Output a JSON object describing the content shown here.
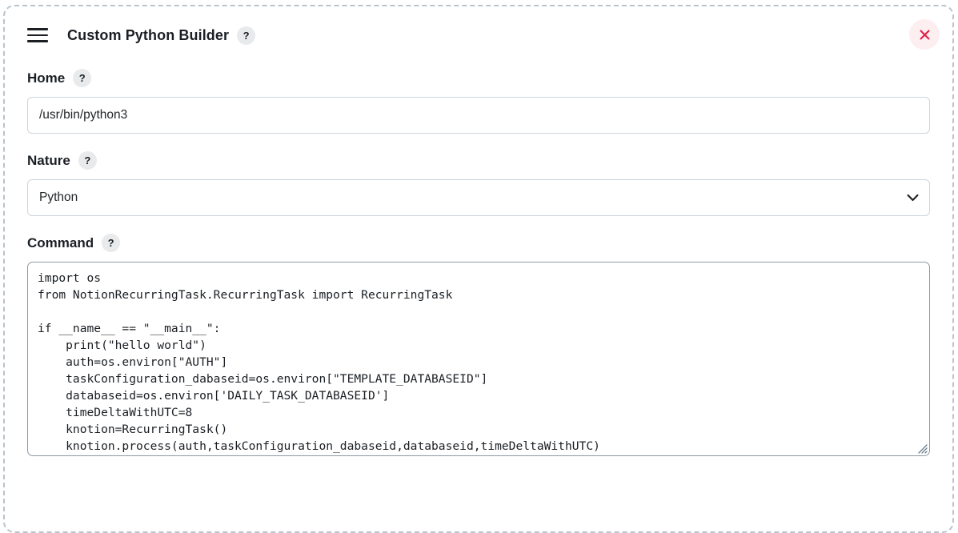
{
  "header": {
    "menu_icon": "hamburger-icon",
    "title": "Custom Python Builder",
    "help_badge": "?",
    "close_icon": "close-icon",
    "accent_close_bg": "#fdeef0",
    "accent_close_fg": "#e0234a"
  },
  "fields": {
    "home": {
      "label": "Home",
      "help_badge": "?",
      "value": "/usr/bin/python3",
      "placeholder": ""
    },
    "nature": {
      "label": "Nature",
      "help_badge": "?",
      "selected": "Python",
      "options": [
        "Python"
      ],
      "chevron_icon": "chevron-down-icon"
    },
    "command": {
      "label": "Command",
      "help_badge": "?",
      "value": "import os\nfrom NotionRecurringTask.RecurringTask import RecurringTask\n\nif __name__ == \"__main__\":\n    print(\"hello world\")\n    auth=os.environ[\"AUTH\"]\n    taskConfiguration_dabaseid=os.environ[\"TEMPLATE_DATABASEID\"]\n    databaseid=os.environ['DAILY_TASK_DATABASEID']\n    timeDeltaWithUTC=8\n    knotion=RecurringTask()\n    knotion.process(auth,taskConfiguration_dabaseid,databaseid,timeDeltaWithUTC)",
      "placeholder": "",
      "resize_handle": "resize-grip-icon"
    }
  },
  "theme": {
    "panel_border": "#b9c4cd",
    "input_border": "#ccd5dc",
    "textarea_border": "#8c9aa6",
    "badge_bg": "#e9eaec",
    "text": "#1b1f24"
  }
}
